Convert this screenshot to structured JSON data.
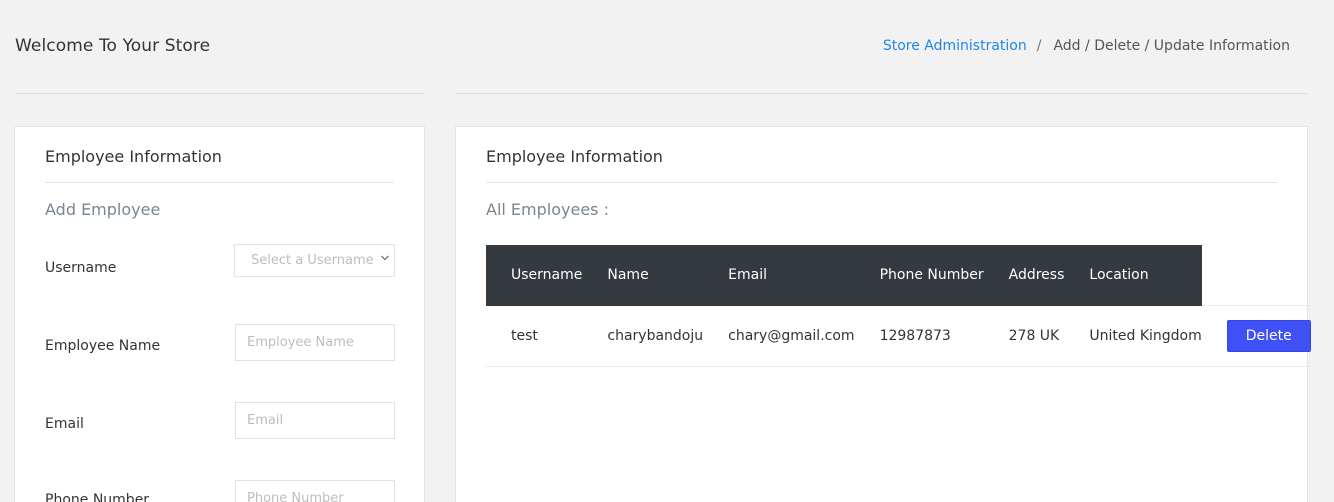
{
  "header": {
    "title": "Welcome To Your Store",
    "breadcrumb": {
      "link": "Store Administration",
      "separator": "/",
      "current": "Add / Delete / Update Information"
    }
  },
  "form_card": {
    "title": "Employee Information",
    "subtitle": "Add Employee",
    "fields": {
      "username_label": "Username",
      "username_placeholder": "Select a Username",
      "employee_name_label": "Employee Name",
      "employee_name_placeholder": "Employee Name",
      "email_label": "Email",
      "email_placeholder": "Email",
      "phone_label": "Phone Number",
      "phone_placeholder": "Phone Number"
    }
  },
  "list_card": {
    "title": "Employee Information",
    "subtitle": "All Employees :",
    "columns": [
      "Username",
      "Name",
      "Email",
      "Phone Number",
      "Address",
      "Location"
    ],
    "rows": [
      {
        "username": "test",
        "name": "charybandoju",
        "email": "chary@gmail.com",
        "phone": "12987873",
        "address": "278 UK",
        "location": "United Kingdom",
        "action": "Delete"
      }
    ]
  },
  "icons": {
    "select_chevron": "chevron-down-icon"
  },
  "colors": {
    "link": "#1e88e5",
    "table_header_bg": "#343a40",
    "delete_button": "#4050f7",
    "page_bg": "#f2f2f2"
  }
}
